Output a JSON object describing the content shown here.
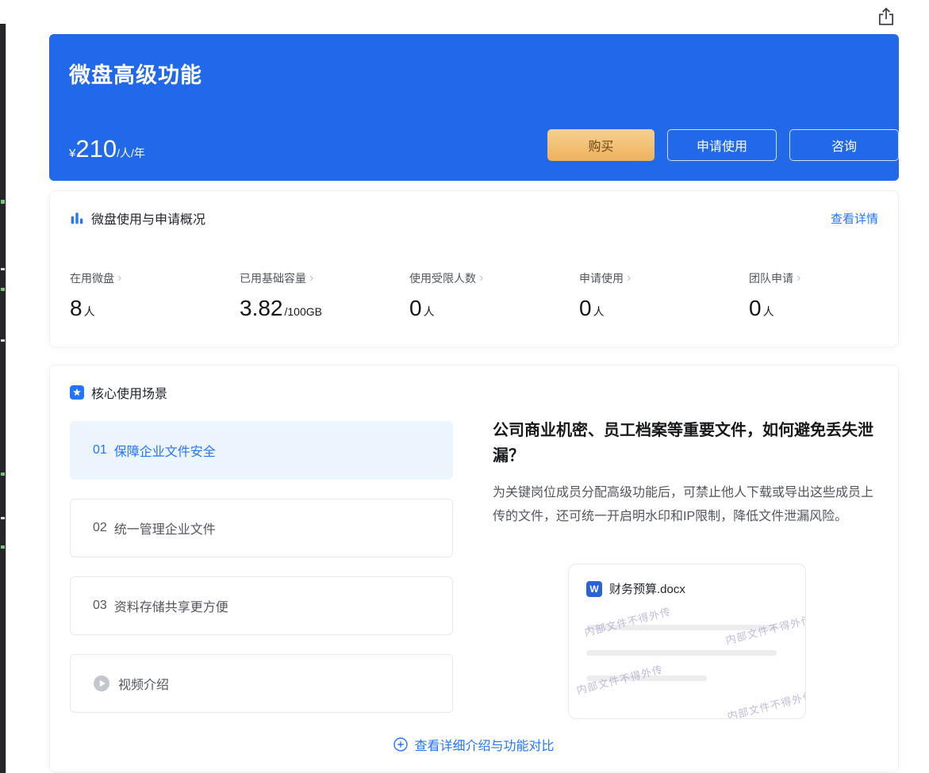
{
  "hero": {
    "title": "微盘高级功能",
    "price_currency": "¥",
    "price_value": "210",
    "price_unit": "/人/年",
    "buttons": {
      "buy": "购买",
      "apply": "申请使用",
      "consult": "咨询"
    }
  },
  "usage": {
    "title": "微盘使用与申请概况",
    "detail_link": "查看详情",
    "stats": [
      {
        "label": "在用微盘",
        "value": "8",
        "unit": "人"
      },
      {
        "label": "已用基础容量",
        "value": "3.82",
        "unit": "/100GB"
      },
      {
        "label": "使用受限人数",
        "value": "0",
        "unit": "人"
      },
      {
        "label": "申请使用",
        "value": "0",
        "unit": "人"
      },
      {
        "label": "团队申请",
        "value": "0",
        "unit": "人"
      }
    ]
  },
  "scenarios": {
    "title": "核心使用场景",
    "items": [
      {
        "index": "01",
        "label": "保障企业文件安全"
      },
      {
        "index": "02",
        "label": "统一管理企业文件"
      },
      {
        "index": "03",
        "label": "资料存储共享更方便"
      }
    ],
    "video_item": "视频介绍",
    "detail": {
      "heading": "公司商业机密、员工档案等重要文件，如何避免丢失泄漏？",
      "body": "为关键岗位成员分配高级功能后，可禁止他人下载或导出这些成员上传的文件，还可统一开启明水印和IP限制，降低文件泄漏风险。",
      "doc_icon_letter": "W",
      "doc_name": "财务预算.docx",
      "watermark": "内部文件不得外传"
    },
    "footer_link": "查看详细介绍与功能对比"
  }
}
